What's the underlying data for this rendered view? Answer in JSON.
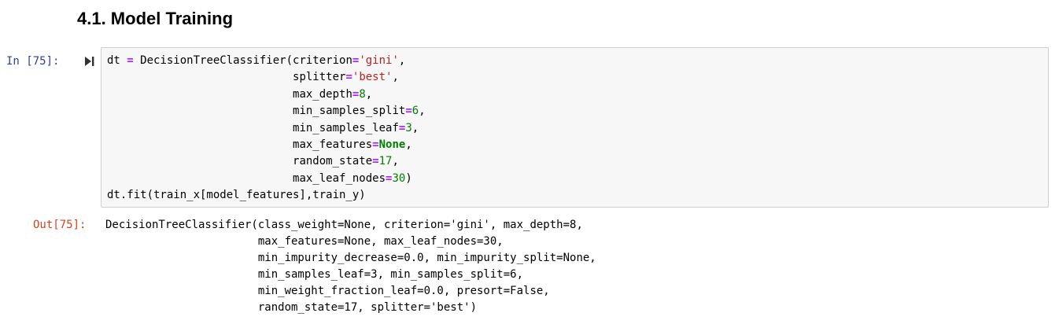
{
  "section": {
    "heading": "4.1. Model Training"
  },
  "input_cell": {
    "prompt": "In [75]:",
    "run_icon": "run-cell-icon",
    "code": {
      "line1": {
        "pre": "dt ",
        "op": "=",
        "call": " DecisionTreeClassifier(criterion",
        "op2": "=",
        "str": "'gini'",
        "post": ","
      },
      "line2": {
        "indent": "                            ",
        "param": "splitter",
        "op": "=",
        "str": "'best'",
        "post": ","
      },
      "line3": {
        "indent": "                            ",
        "param": "max_depth",
        "op": "=",
        "num": "8",
        "post": ","
      },
      "line4": {
        "indent": "                            ",
        "param": "min_samples_split",
        "op": "=",
        "num": "6",
        "post": ","
      },
      "line5": {
        "indent": "                            ",
        "param": "min_samples_leaf",
        "op": "=",
        "num": "3",
        "post": ","
      },
      "line6": {
        "indent": "                            ",
        "param": "max_features",
        "op": "=",
        "kw": "None",
        "post": ","
      },
      "line7": {
        "indent": "                            ",
        "param": "random_state",
        "op": "=",
        "num": "17",
        "post": ","
      },
      "line8": {
        "indent": "                            ",
        "param": "max_leaf_nodes",
        "op": "=",
        "num": "30",
        "post": ")"
      },
      "line9": "dt.fit(train_x[model_features],train_y)"
    }
  },
  "output_cell": {
    "prompt": "Out[75]:",
    "lines": [
      "DecisionTreeClassifier(class_weight=None, criterion='gini', max_depth=8,",
      "                       max_features=None, max_leaf_nodes=30,",
      "                       min_impurity_decrease=0.0, min_impurity_split=None,",
      "                       min_samples_leaf=3, min_samples_split=6,",
      "                       min_weight_fraction_leaf=0.0, presort=False,",
      "                       random_state=17, splitter='best')"
    ]
  },
  "colors": {
    "input_prompt": "#303f9f",
    "output_prompt": "#d84315",
    "operator": "#aa22ff",
    "string": "#ba2121",
    "number": "#008000",
    "keyword": "#008000",
    "cell_background": "#f7f7f7",
    "cell_border": "#cfcfcf"
  }
}
